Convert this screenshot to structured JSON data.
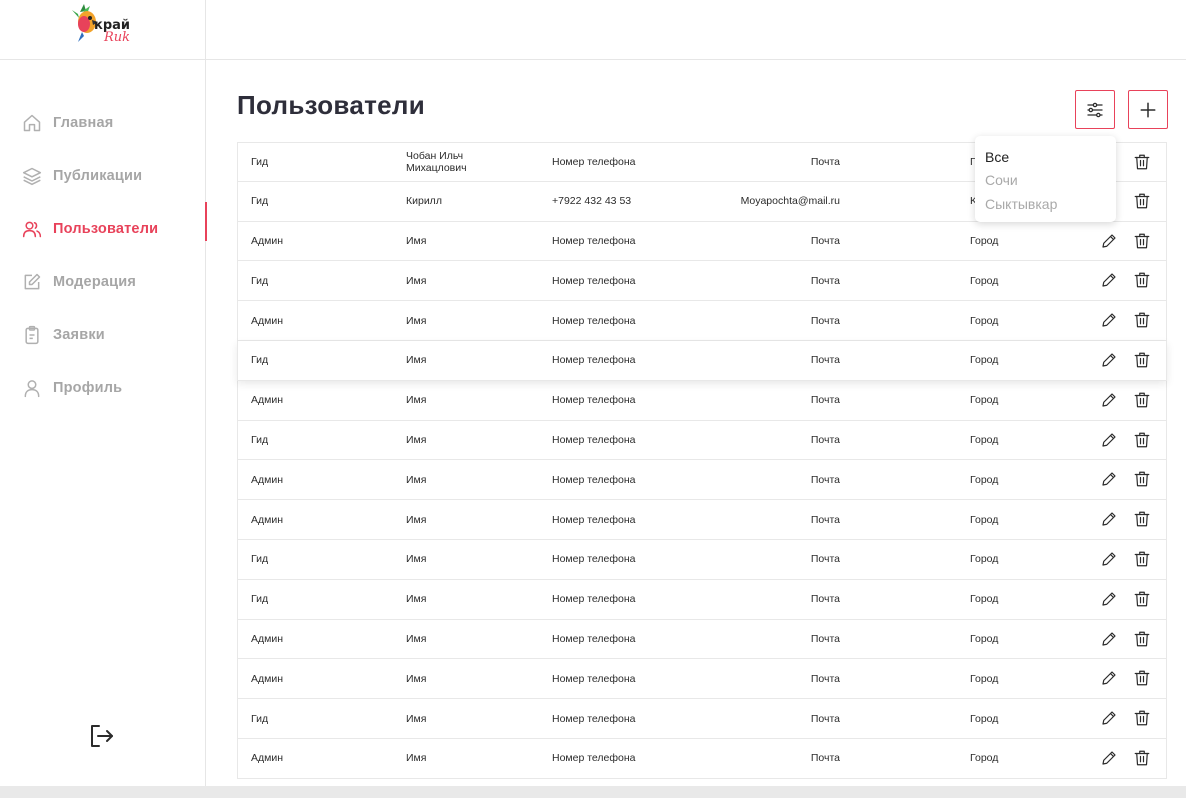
{
  "logo": {
    "text": "край",
    "script": "Ruk"
  },
  "nav": [
    {
      "label": "Главная",
      "icon": "home-icon",
      "active": false
    },
    {
      "label": "Публикации",
      "icon": "layers-icon",
      "active": false
    },
    {
      "label": "Пользователи",
      "icon": "users-icon",
      "active": true
    },
    {
      "label": "Модерация",
      "icon": "edit-square-icon",
      "active": false
    },
    {
      "label": "Заявки",
      "icon": "clipboard-icon",
      "active": false
    },
    {
      "label": "Профиль",
      "icon": "user-icon",
      "active": false
    }
  ],
  "page": {
    "title": "Пользователи"
  },
  "colors": {
    "accent": "#e8425a",
    "muted": "#a6a6a6"
  },
  "filter_dropdown": {
    "options": [
      "Все",
      "Сочи",
      "Сыктывкар"
    ],
    "selected": "Все"
  },
  "table": {
    "rows": [
      {
        "role": "Гид",
        "name": "Чобан Ильч Михацлович",
        "phone": "Номер телефона",
        "email": "Почта",
        "city": "Город"
      },
      {
        "role": "Гид",
        "name": "Кирилл",
        "phone": "+7922 432 43 53",
        "email": "Moyapochta@mail.ru",
        "city": "Kaliningrad"
      },
      {
        "role": "Админ",
        "name": "Имя",
        "phone": "Номер телефона",
        "email": "Почта",
        "city": "Город"
      },
      {
        "role": "Гид",
        "name": "Имя",
        "phone": "Номер телефона",
        "email": "Почта",
        "city": "Город"
      },
      {
        "role": "Админ",
        "name": "Имя",
        "phone": "Номер телефона",
        "email": "Почта",
        "city": "Город"
      },
      {
        "role": "Гид",
        "name": "Имя",
        "phone": "Номер телефона",
        "email": "Почта",
        "city": "Город"
      },
      {
        "role": "Админ",
        "name": "Имя",
        "phone": "Номер телефона",
        "email": "Почта",
        "city": "Город"
      },
      {
        "role": "Гид",
        "name": "Имя",
        "phone": "Номер телефона",
        "email": "Почта",
        "city": "Город"
      },
      {
        "role": "Админ",
        "name": "Имя",
        "phone": "Номер телефона",
        "email": "Почта",
        "city": "Город"
      },
      {
        "role": "Админ",
        "name": "Имя",
        "phone": "Номер телефона",
        "email": "Почта",
        "city": "Город"
      },
      {
        "role": "Гид",
        "name": "Имя",
        "phone": "Номер телефона",
        "email": "Почта",
        "city": "Город"
      },
      {
        "role": "Гид",
        "name": "Имя",
        "phone": "Номер телефона",
        "email": "Почта",
        "city": "Город"
      },
      {
        "role": "Админ",
        "name": "Имя",
        "phone": "Номер телефона",
        "email": "Почта",
        "city": "Город"
      },
      {
        "role": "Админ",
        "name": "Имя",
        "phone": "Номер телефона",
        "email": "Почта",
        "city": "Город"
      },
      {
        "role": "Гид",
        "name": "Имя",
        "phone": "Номер телефона",
        "email": "Почта",
        "city": "Город"
      },
      {
        "role": "Админ",
        "name": "Имя",
        "phone": "Номер телефона",
        "email": "Почта",
        "city": "Город"
      }
    ]
  }
}
